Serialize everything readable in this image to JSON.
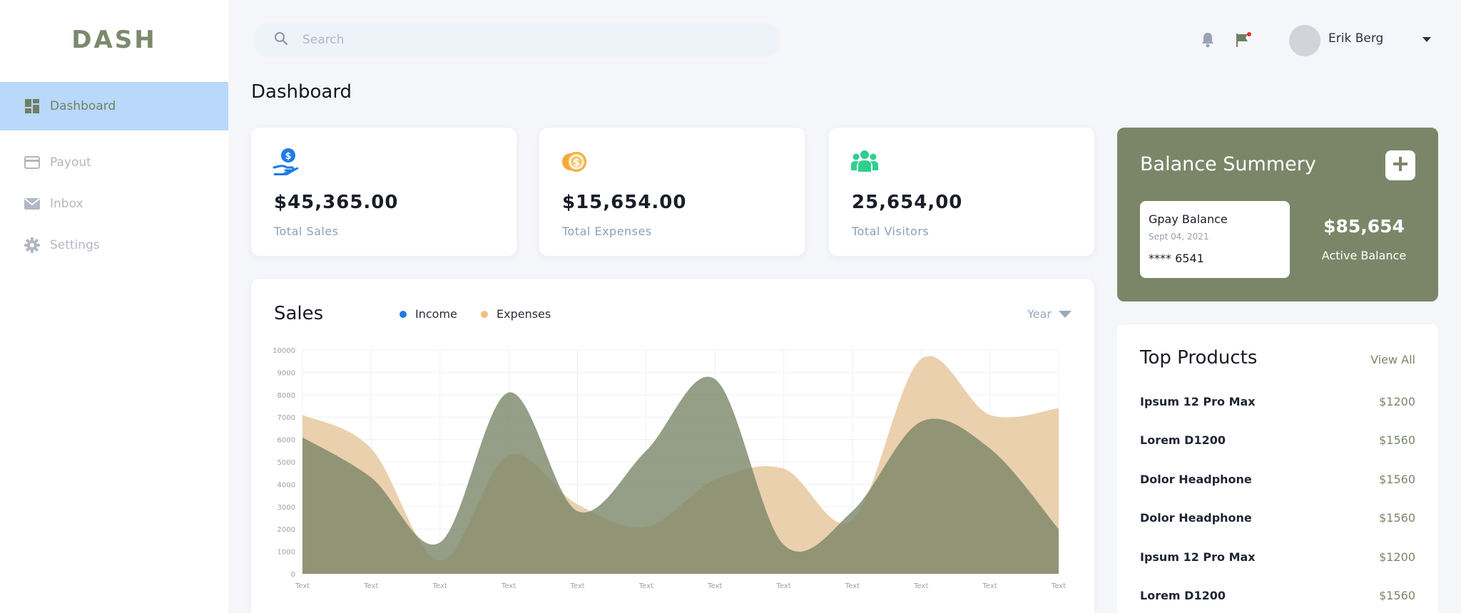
{
  "app": {
    "logo": "DASH"
  },
  "sidebar": {
    "items": [
      {
        "label": "Dashboard",
        "icon": "dashboard-icon",
        "active": true
      },
      {
        "label": "Payout",
        "icon": "credit-card-icon"
      },
      {
        "label": "Inbox",
        "icon": "mail-icon"
      },
      {
        "label": "Settings",
        "icon": "gear-icon"
      }
    ]
  },
  "header": {
    "search_placeholder": "Search",
    "user_name": "Erik Berg"
  },
  "page": {
    "title": "Dashboard"
  },
  "stats": [
    {
      "value": "$45,365.00",
      "label": "Total Sales",
      "icon": "money-hand-icon"
    },
    {
      "value": "$15,654.00",
      "label": "Total Expenses",
      "icon": "coins-icon"
    },
    {
      "value": "25,654,00",
      "label": "Total Visitors",
      "icon": "users-icon"
    }
  ],
  "sales": {
    "title": "Sales",
    "legend": [
      "Income",
      "Expenses"
    ],
    "period": "Year"
  },
  "chart_data": {
    "type": "area",
    "title": "Sales",
    "x": [
      "Text",
      "Text",
      "Text",
      "Text",
      "Text",
      "Text",
      "Text",
      "Text",
      "Text",
      "Text",
      "Text",
      "Text"
    ],
    "yticks": [
      "0",
      "1000",
      "2000",
      "3000",
      "4000",
      "5000",
      "6000",
      "7000",
      "8000",
      "9000",
      "10000"
    ],
    "ylim": [
      0,
      10000
    ],
    "grid": true,
    "legend_position": "top",
    "series": [
      {
        "name": "Income",
        "color": "#7b8668",
        "values": [
          6100,
          4300,
          1400,
          8100,
          2800,
          5500,
          8700,
          1300,
          2800,
          6800,
          5600,
          2000
        ]
      },
      {
        "name": "Expenses",
        "color": "#e8c8a0",
        "values": [
          7100,
          5600,
          600,
          5300,
          3100,
          2100,
          4200,
          4700,
          2400,
          9600,
          7100,
          7400
        ]
      }
    ]
  },
  "balance": {
    "title": "Balance Summery",
    "card_title": "Gpay Balance",
    "card_date": "Sept 04, 2021",
    "card_number": "**** 6541",
    "amount": "$85,654",
    "amount_label": "Active Balance"
  },
  "products": {
    "title": "Top Products",
    "view_all": "View All",
    "items": [
      {
        "name": "Ipsum 12 Pro Max",
        "price": "$1200"
      },
      {
        "name": "Lorem D1200",
        "price": "$1560"
      },
      {
        "name": "Dolor Headphone",
        "price": "$1560"
      },
      {
        "name": "Dolor Headphone",
        "price": "$1560"
      },
      {
        "name": "Ipsum 12 Pro Max",
        "price": "$1200"
      },
      {
        "name": "Lorem D1200",
        "price": "$1560"
      }
    ]
  },
  "colors": {
    "accent": "#7b8668",
    "sidebar_active": "#b9d8fa",
    "income": "#7b8668",
    "expenses": "#e8c8a0",
    "legend_income_dot": "#1e7be6",
    "legend_expenses_dot": "#f2c07a"
  }
}
